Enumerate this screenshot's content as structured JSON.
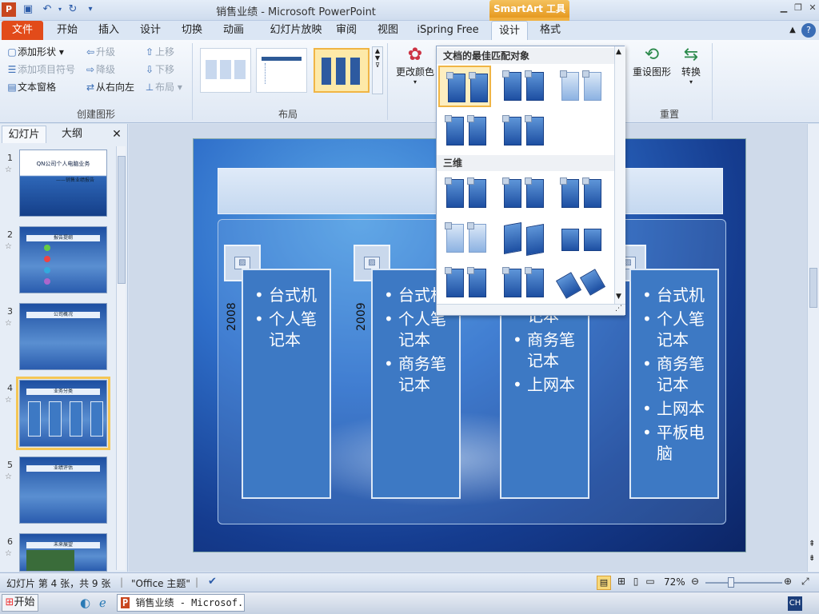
{
  "app": {
    "title": "销售业绩 - Microsoft PowerPoint",
    "context_tab": "SmartArt 工具"
  },
  "tabs": [
    "文件",
    "开始",
    "插入",
    "设计",
    "切换",
    "动画",
    "幻灯片放映",
    "审阅",
    "视图",
    "iSpring Free",
    "设计",
    "格式"
  ],
  "ribbon": {
    "create_graphic": {
      "add_shape": "添加形状",
      "add_bullet": "添加项目符号",
      "text_pane": "文本窗格",
      "promote": "升级",
      "demote": "降级",
      "right_to_left": "从右向左",
      "move_up": "上移",
      "move_down": "下移",
      "layout": "布局",
      "group_label": "创建图形"
    },
    "layouts_group_label": "布局",
    "change_colors": "更改颜色",
    "reset_graphic": "重设图形",
    "convert": "转换",
    "reset_group_label": "重置"
  },
  "slides_pane": {
    "tab_slides": "幻灯片",
    "tab_outline": "大纲",
    "slides": [
      {
        "num": "1",
        "title": "QN公司个人电脑业务",
        "subtitle": "——销售业绩报告"
      },
      {
        "num": "2",
        "title": "报告提纲"
      },
      {
        "num": "3",
        "title": "公司概况"
      },
      {
        "num": "4",
        "title": "业务分类"
      },
      {
        "num": "5",
        "title": "业绩评估"
      },
      {
        "num": "6",
        "title": "未来展望"
      }
    ]
  },
  "slide": {
    "title": "业",
    "cards": [
      {
        "year": "2008",
        "items": [
          "台式机",
          "个人笔记本"
        ]
      },
      {
        "year": "2009",
        "items": [
          "台式机",
          "个人笔记本",
          "商务笔记本"
        ]
      },
      {
        "year": "",
        "items": [
          "个人笔记本",
          "商务笔记本",
          "上网本"
        ]
      },
      {
        "year": "",
        "items": [
          "台式机",
          "个人笔记本",
          "商务笔记本",
          "上网本",
          "平板电脑"
        ]
      }
    ]
  },
  "dropdown": {
    "section1": "文档的最佳匹配对象",
    "section2": "三维"
  },
  "status": {
    "slide_info": "幻灯片 第 4 张，共 9 张",
    "theme": "\"Office 主题\"",
    "zoom": "72%"
  },
  "taskbar": {
    "start": "开始",
    "ppt_task": "销售业绩 - Microsof...",
    "ime": "CH"
  },
  "colors": {
    "file_tab": "#e24b1a",
    "context_accent": "#f0b040",
    "card_fill": "#3d79c4"
  }
}
